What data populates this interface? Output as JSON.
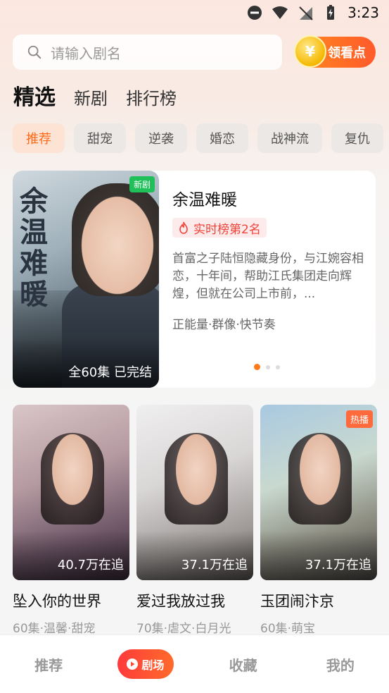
{
  "status_bar": {
    "time": "3:23"
  },
  "search": {
    "placeholder": "请输入剧名"
  },
  "coin_button": {
    "label": "领看点",
    "coin_symbol": "¥"
  },
  "main_tabs": [
    "精选",
    "新剧",
    "排行榜"
  ],
  "categories": [
    "推荐",
    "甜宠",
    "逆袭",
    "婚恋",
    "战神流",
    "复仇"
  ],
  "featured": {
    "poster_text": "余温难暖",
    "badge": "新剧",
    "episode_info": "全60集 已完结",
    "title": "余温难暖",
    "rank": "实时榜第2名",
    "description": "首富之子陆恒隐藏身份，与江婉容相恋，十年间，帮助江氏集团走向辉煌，但就在公司上市前，...",
    "tags": "正能量·群像·快节奏",
    "page_index": 0,
    "page_count": 3
  },
  "dramas": [
    {
      "title": "坠入你的世界",
      "tags": "60集·温馨·甜宠",
      "views": "40.7万在追",
      "poster_text": "坠入你的世界",
      "badge": ""
    },
    {
      "title": "爱过我放过我",
      "tags": "70集·虐文·白月光",
      "views": "37.1万在追",
      "poster_text": "爱过我放过我",
      "badge": ""
    },
    {
      "title": "玉团闹汴京",
      "tags": "60集·萌宝",
      "views": "37.1万在追",
      "poster_text": "玉团闹汴京",
      "badge": "热播"
    }
  ],
  "bottom_nav": [
    "推荐",
    "剧场",
    "收藏",
    "我的"
  ],
  "colors": {
    "accent": "#ff6a1a",
    "rank_red": "#f0443a",
    "new_green": "#1fbf5a"
  }
}
